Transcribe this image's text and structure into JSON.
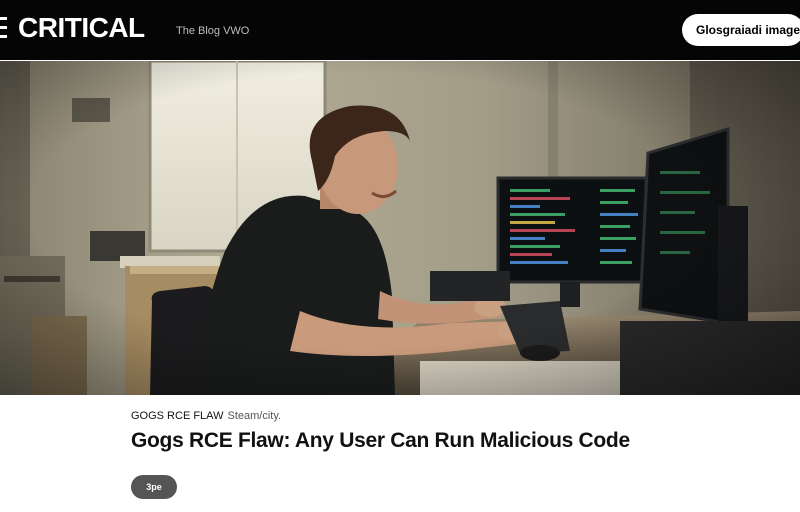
{
  "header": {
    "brand": "CRITICAL",
    "tagline": "The Blog VWO",
    "cta_label": "Glosgraiadi image"
  },
  "hero": {
    "image_alt": "Smiling man with curly hair working at a desk in front of monitors showing code"
  },
  "article": {
    "kicker": "GOGS RCE FLAW",
    "kicker_sub": "Steam/city.",
    "headline": "Gogs RCE Flaw: Any User Can Run Malicious Code",
    "button_label": "3pe"
  }
}
